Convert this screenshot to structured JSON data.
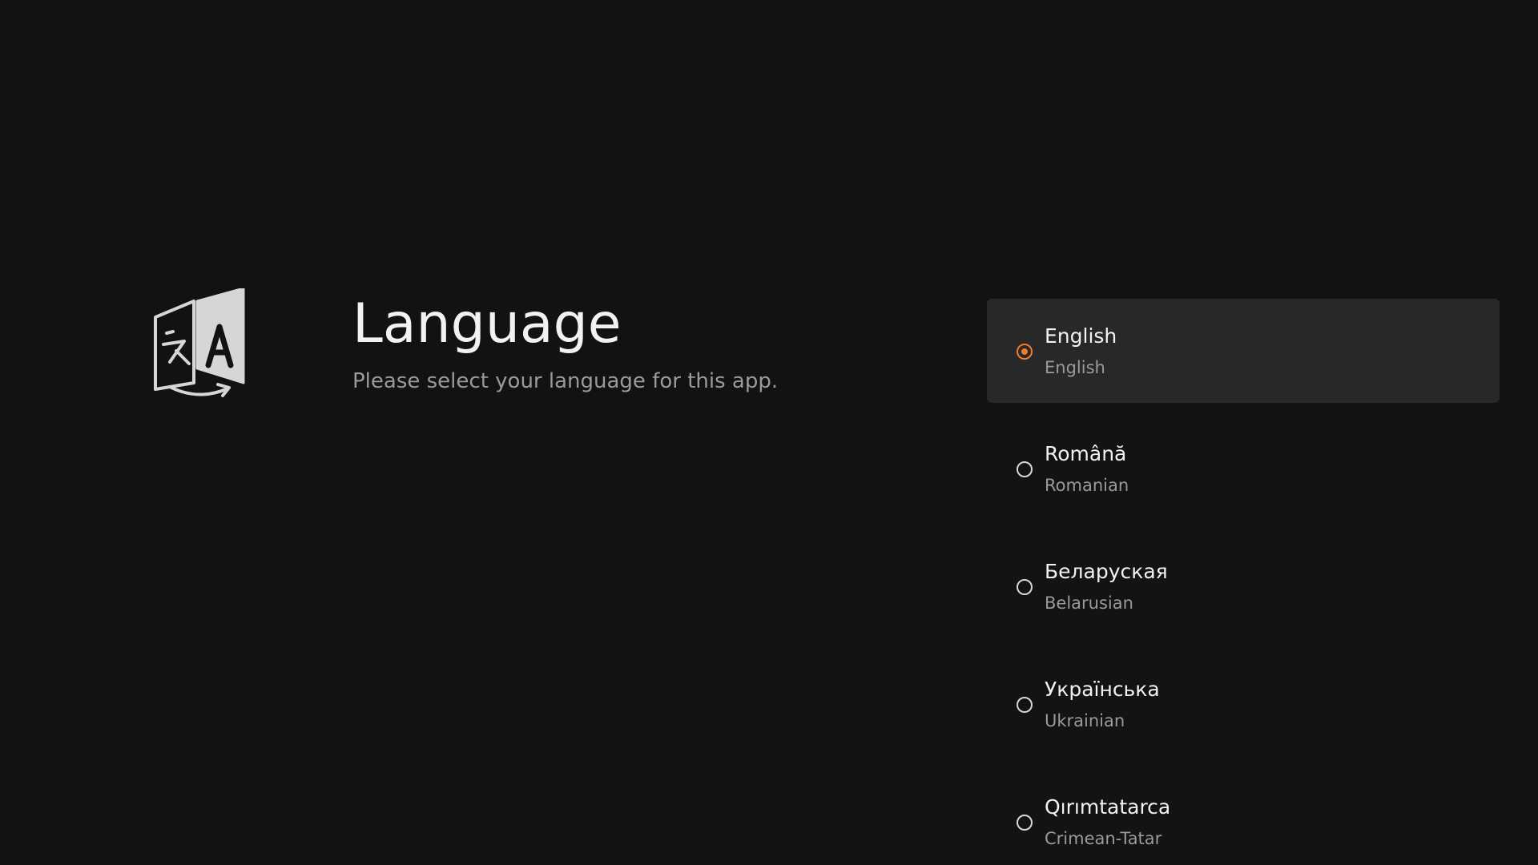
{
  "header": {
    "title": "Language",
    "subtitle": "Please select your language for this app."
  },
  "icons": {
    "language": "translate-icon"
  },
  "colors": {
    "accent": "#ee7d2a",
    "selected_bg": "#282828",
    "text_primary": "#f2f2f2",
    "text_secondary": "#9a9a9a"
  },
  "languages": [
    {
      "native": "English",
      "english": "English",
      "selected": true
    },
    {
      "native": "Română",
      "english": "Romanian",
      "selected": false
    },
    {
      "native": "Беларуская",
      "english": "Belarusian",
      "selected": false
    },
    {
      "native": "Українська",
      "english": "Ukrainian",
      "selected": false
    },
    {
      "native": "Qırımtatarca",
      "english": "Crimean-Tatar",
      "selected": false
    }
  ]
}
